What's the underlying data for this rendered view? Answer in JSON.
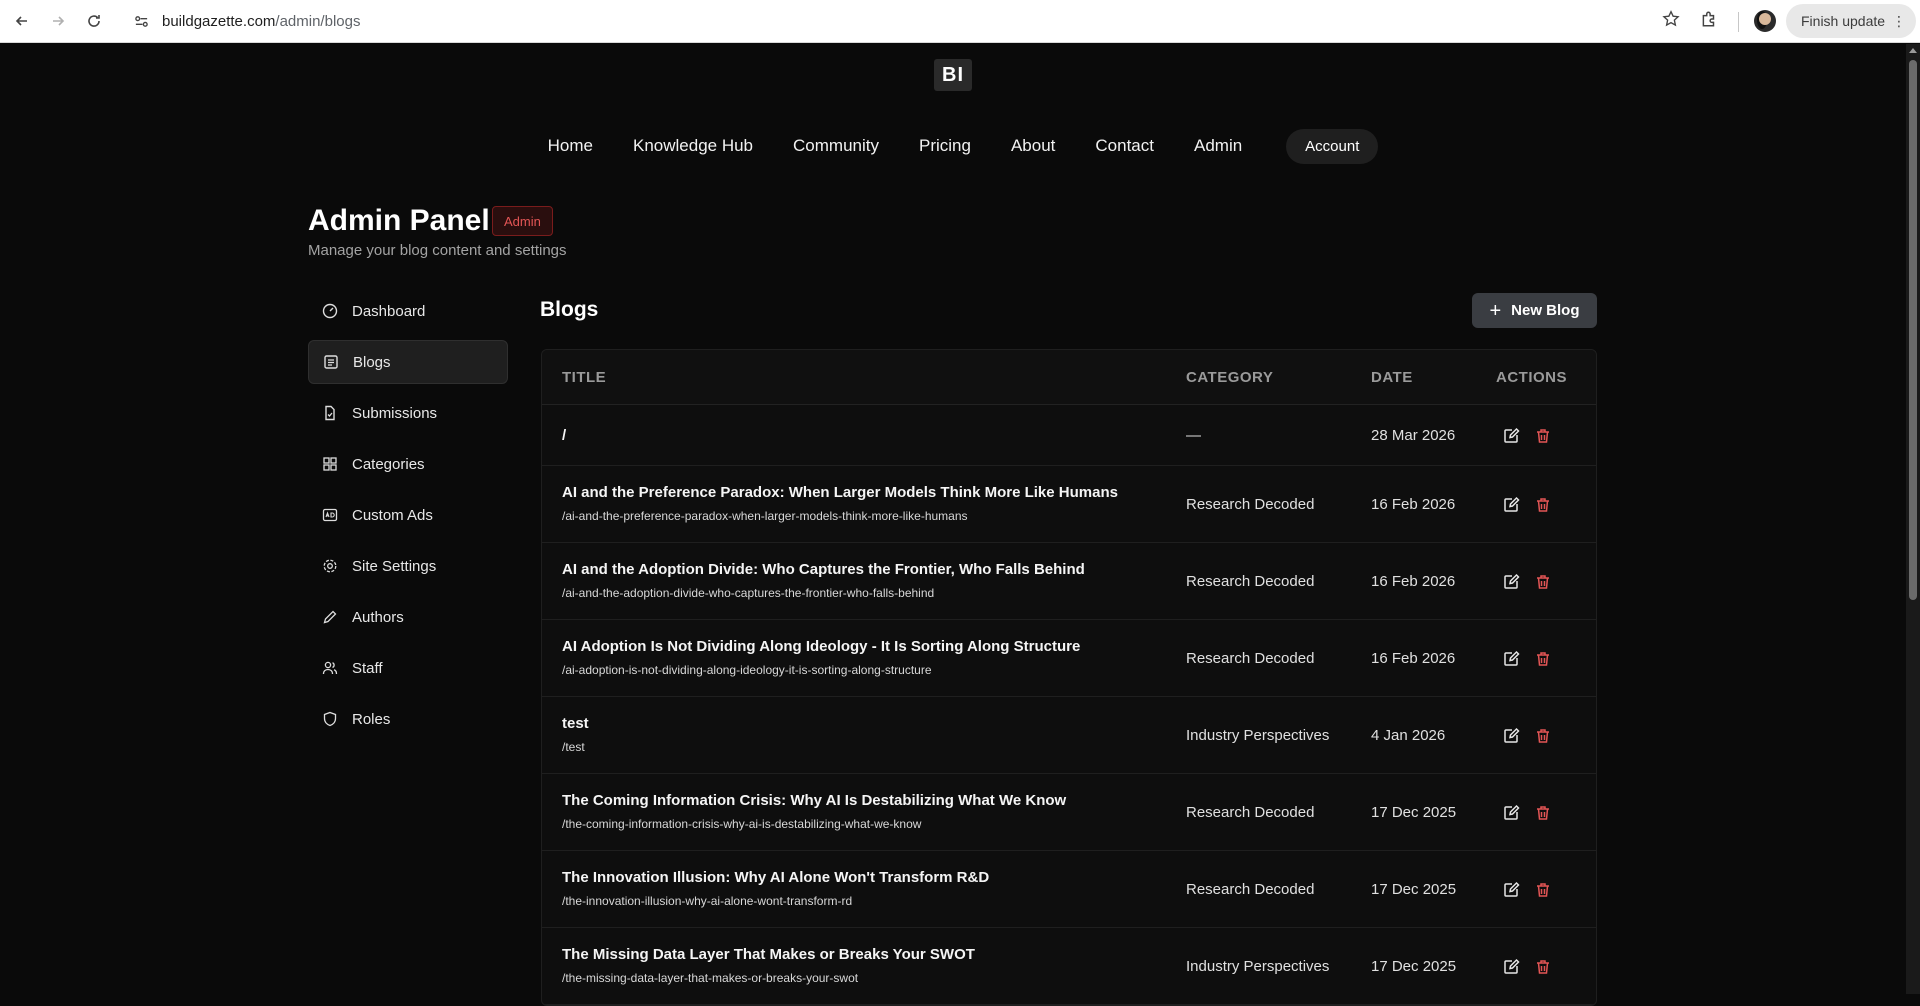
{
  "browser": {
    "url_host": "buildgazette.com",
    "url_path": "/admin/blogs",
    "finish_update": "Finish update"
  },
  "site": {
    "logo": "BI",
    "nav": [
      "Home",
      "Knowledge Hub",
      "Community",
      "Pricing",
      "About",
      "Contact",
      "Admin"
    ],
    "account": "Account"
  },
  "header": {
    "title": "Admin Panel",
    "badge": "Admin",
    "subtitle": "Manage your blog content and settings"
  },
  "sidebar": {
    "items": [
      {
        "label": "Dashboard",
        "icon": "dashboard-icon"
      },
      {
        "label": "Blogs",
        "icon": "document-list-icon",
        "active": true
      },
      {
        "label": "Submissions",
        "icon": "file-check-icon"
      },
      {
        "label": "Categories",
        "icon": "grid-icon"
      },
      {
        "label": "Custom Ads",
        "icon": "ad-icon"
      },
      {
        "label": "Site Settings",
        "icon": "gear-icon"
      },
      {
        "label": "Authors",
        "icon": "pencil-icon"
      },
      {
        "label": "Staff",
        "icon": "users-icon"
      },
      {
        "label": "Roles",
        "icon": "shield-icon"
      }
    ]
  },
  "main": {
    "title": "Blogs",
    "new_blog": "New Blog",
    "columns": [
      "TITLE",
      "CATEGORY",
      "DATE",
      "ACTIONS"
    ],
    "rows": [
      {
        "title": "/",
        "slug": "",
        "category": "—",
        "date": "28 Mar 2026"
      },
      {
        "title": "AI and the Preference Paradox: When Larger Models Think More Like Humans",
        "slug": "/ai-and-the-preference-paradox-when-larger-models-think-more-like-humans",
        "category": "Research Decoded",
        "date": "16 Feb 2026"
      },
      {
        "title": "AI and the Adoption Divide: Who Captures the Frontier, Who Falls Behind",
        "slug": "/ai-and-the-adoption-divide-who-captures-the-frontier-who-falls-behind",
        "category": "Research Decoded",
        "date": "16 Feb 2026"
      },
      {
        "title": "AI Adoption Is Not Dividing Along Ideology - It Is Sorting Along Structure",
        "slug": "/ai-adoption-is-not-dividing-along-ideology-it-is-sorting-along-structure",
        "category": "Research Decoded",
        "date": "16 Feb 2026"
      },
      {
        "title": "test",
        "slug": "/test",
        "category": "Industry Perspectives",
        "date": "4 Jan 2026"
      },
      {
        "title": "The Coming Information Crisis: Why AI Is Destabilizing What We Know",
        "slug": "/the-coming-information-crisis-why-ai-is-destabilizing-what-we-know",
        "category": "Research Decoded",
        "date": "17 Dec 2025"
      },
      {
        "title": "The Innovation Illusion: Why AI Alone Won't Transform R&D",
        "slug": "/the-innovation-illusion-why-ai-alone-wont-transform-rd",
        "category": "Research Decoded",
        "date": "17 Dec 2025"
      },
      {
        "title": "The Missing Data Layer That Makes or Breaks Your SWOT",
        "slug": "/the-missing-data-layer-that-makes-or-breaks-your-swot",
        "category": "Industry Perspectives",
        "date": "17 Dec 2025"
      }
    ]
  },
  "colors": {
    "background": "#0a0a0a",
    "accent_red": "#e25555",
    "button_bg": "#3a3d42"
  }
}
